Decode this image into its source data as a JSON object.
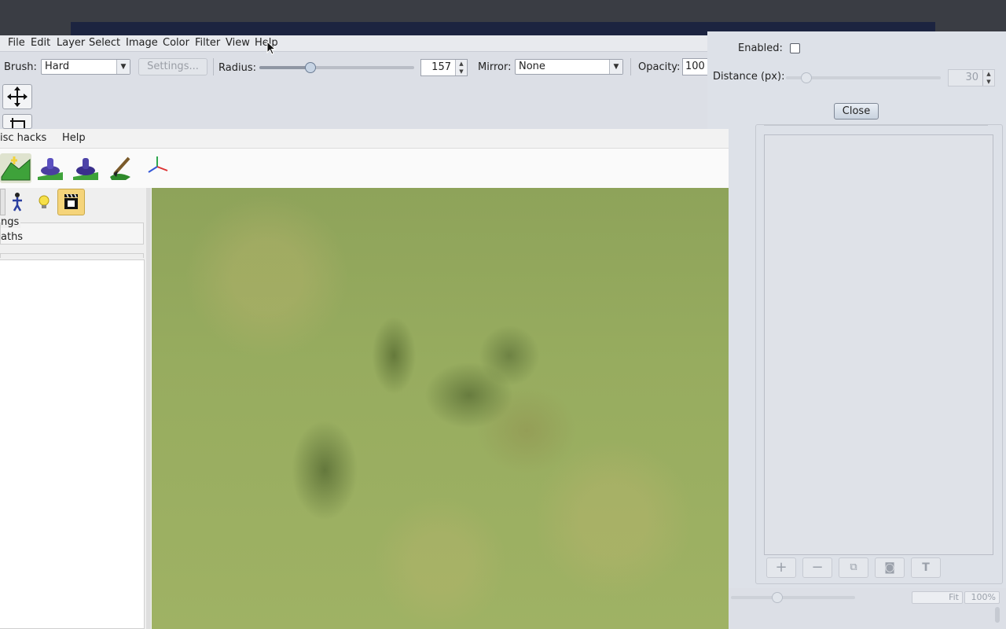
{
  "paint_app": {
    "menu": [
      "File",
      "Edit",
      "Layer",
      "Select",
      "Image",
      "Color",
      "Filter",
      "View",
      "Help"
    ],
    "toolbar": {
      "brush_label": "Brush:",
      "brush_value": "Hard",
      "settings_label": "Settings...",
      "radius_label": "Radius:",
      "radius_value": "157",
      "mirror_label": "Mirror:",
      "mirror_value": "None",
      "opacity_label": "Opacity:",
      "opacity_value": "100"
    },
    "tools": [
      "move-icon",
      "crop-icon"
    ]
  },
  "dialog": {
    "enabled_label": "Enabled:",
    "enabled_checked": false,
    "distance_label": "Distance (px):",
    "distance_value": "30",
    "close_label": "Close",
    "layer_buttons": [
      "add-icon",
      "remove-icon",
      "duplicate-icon",
      "mask-icon",
      "text-icon"
    ]
  },
  "status": {
    "fit_label": "Fit",
    "zoom_label": "100%"
  },
  "editor": {
    "menu_visible": [
      "isc hacks",
      "Help"
    ],
    "toolbar_icons": [
      "terrain-icon",
      "paint-brush-blue-icon",
      "paint-brush-purple-icon",
      "texture-brush-icon",
      "axis-gizmo-icon"
    ],
    "secondary_icons": [
      "panel-icon",
      "person-icon",
      "light-icon",
      "clapper-icon"
    ],
    "panel_rows": [
      "ngs",
      "aths"
    ]
  },
  "colors": {
    "accent": "#7f8896",
    "grass": "#97ac5f"
  }
}
